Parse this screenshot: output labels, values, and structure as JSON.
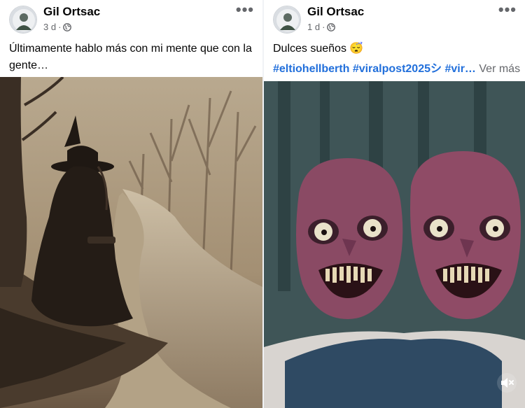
{
  "posts": [
    {
      "author": "Gil Ortsac",
      "time": "3 d",
      "separator": "·",
      "privacy_icon": "globe-icon",
      "more_icon": "more-options-icon",
      "more_label": "•••",
      "caption": "Últimamente hablo más con mi mente que con la gente…",
      "media": "witch-by-river-illustration"
    },
    {
      "author": "Gil Ortsac",
      "time": "1 d",
      "separator": "·",
      "privacy_icon": "globe-icon",
      "more_icon": "more-options-icon",
      "more_label": "•••",
      "caption": "Dulces sueños 😴",
      "hashtags": [
        "#eltiohellberth",
        "#viralpost2025シ",
        "#vir…"
      ],
      "see_more": "Ver más",
      "media": "two-creepy-faces-video",
      "video_control": "muted-speaker-icon"
    }
  ],
  "colors": {
    "text_primary": "#050505",
    "text_secondary": "#65676b",
    "hashtag": "#216fdb",
    "background": "#ffffff"
  }
}
